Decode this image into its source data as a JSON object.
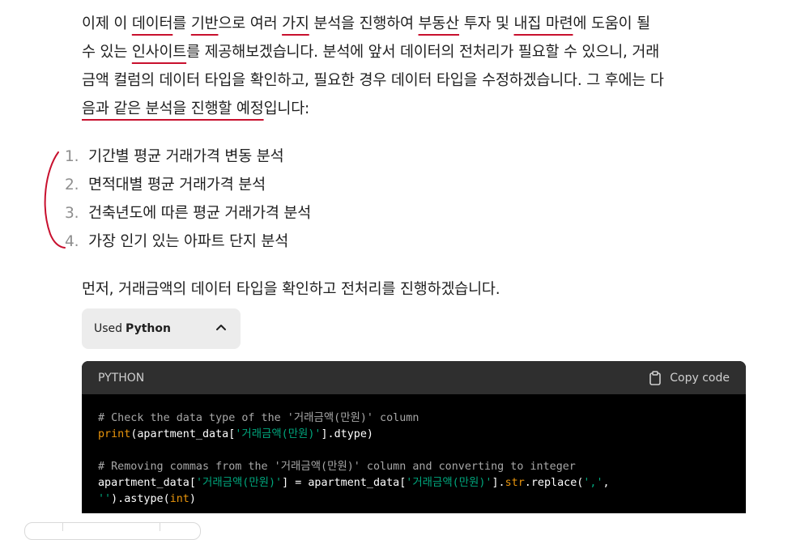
{
  "paragraph": {
    "line1": [
      {
        "t": "이제 이 ",
        "u": false
      },
      {
        "t": "데이터",
        "u": true
      },
      {
        "t": "를 ",
        "u": false
      },
      {
        "t": "기반",
        "u": true
      },
      {
        "t": "으로 여러 ",
        "u": false
      },
      {
        "t": "가지",
        "u": true
      },
      {
        "t": " 분석을 진행하여 ",
        "u": false
      },
      {
        "t": "부동산",
        "u": true
      },
      {
        "t": " 투자 및 ",
        "u": false
      },
      {
        "t": "내집 마련",
        "u": true
      },
      {
        "t": "에 도움이 될",
        "u": false
      }
    ],
    "line2": [
      {
        "t": "수 있는 ",
        "u": false
      },
      {
        "t": "인사이트",
        "u": true
      },
      {
        "t": "를 제공해보겠습니다. 분석에 앞서 데이터의 전처리가 필요할 수 있으니, 거래",
        "u": false
      }
    ],
    "line3": [
      {
        "t": "금액 컬럼의 데이터 타입을 확인하고, 필요한 경우 데이터 타입을 수정하겠습니다. 그 후에는 다",
        "u": false
      }
    ],
    "line4": [
      {
        "t": "음과 같은 분석을 진행할 예정",
        "u": true
      },
      {
        "t": "입니다:",
        "u": false
      }
    ]
  },
  "list": [
    {
      "num": "1.",
      "text": "기간별 평균 거래가격 변동 분석"
    },
    {
      "num": "2.",
      "text": "면적대별 평균 거래가격 분석"
    },
    {
      "num": "3.",
      "text": "건축년도에 따른 평균 거래가격 분석"
    },
    {
      "num": "4.",
      "text": "가장 인기 있는 아파트 단지 분석"
    }
  ],
  "intro": "먼저, 거래금액의 데이터 타입을 확인하고 전처리를 진행하겠습니다.",
  "used_python": {
    "prefix": "Used",
    "lang": "Python"
  },
  "code_block": {
    "lang_label": "PYTHON",
    "copy_label": "Copy code",
    "lines": [
      [
        {
          "c": "cm",
          "t": "# Check the data type of the '거래금액(만원)' column"
        }
      ],
      [
        {
          "c": "fn",
          "t": "print"
        },
        {
          "c": "",
          "t": "(apartment_data["
        },
        {
          "c": "st",
          "t": "'거래금액(만원)'"
        },
        {
          "c": "",
          "t": "].dtype)"
        }
      ],
      [
        {
          "c": "",
          "t": ""
        }
      ],
      [
        {
          "c": "cm",
          "t": "# Removing commas from the '거래금액(만원)' column and converting to integer"
        }
      ],
      [
        {
          "c": "",
          "t": "apartment_data["
        },
        {
          "c": "st",
          "t": "'거래금액(만원)'"
        },
        {
          "c": "",
          "t": "] = apartment_data["
        },
        {
          "c": "st",
          "t": "'거래금액(만원)'"
        },
        {
          "c": "",
          "t": "]."
        },
        {
          "c": "fn",
          "t": "str"
        },
        {
          "c": "",
          "t": ".replace("
        },
        {
          "c": "st",
          "t": "','"
        },
        {
          "c": "",
          "t": ","
        }
      ],
      [
        {
          "c": "st",
          "t": "''"
        },
        {
          "c": "",
          "t": ").astype("
        },
        {
          "c": "bi",
          "t": "int"
        },
        {
          "c": "",
          "t": ")"
        }
      ]
    ]
  },
  "colors": {
    "underline": "#c8102e",
    "code_bg": "#000000",
    "code_header_bg": "#2f2f2f"
  }
}
